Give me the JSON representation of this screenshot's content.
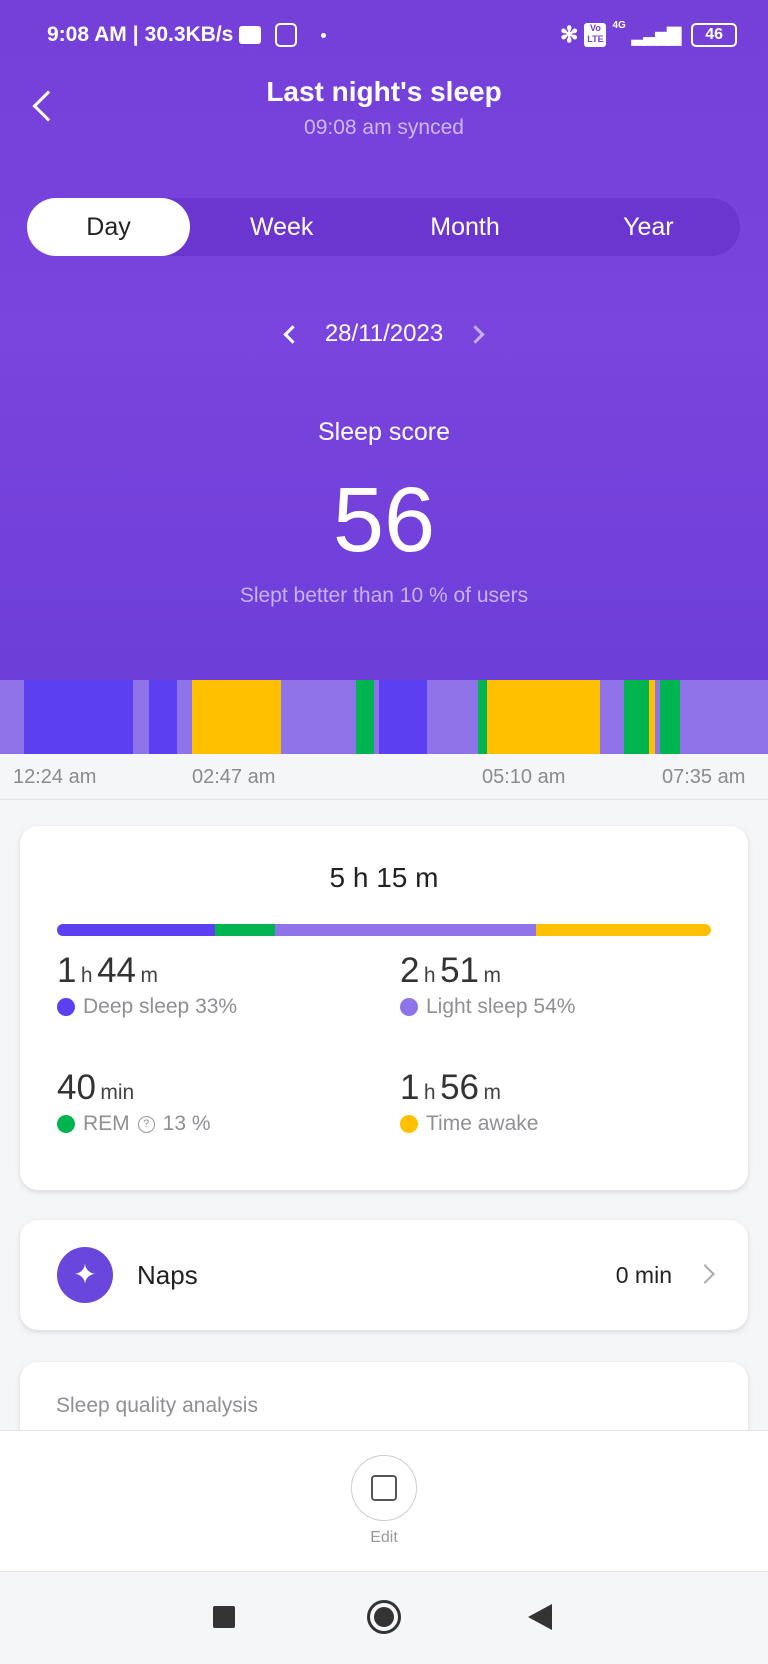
{
  "status_bar": {
    "time": "9:08 AM",
    "speed": "30.3KB/s",
    "battery": "46",
    "network": "4G",
    "volte": "Vo LTE"
  },
  "header": {
    "title": "Last night's sleep",
    "synced": "09:08 am synced"
  },
  "tabs": [
    {
      "label": "Day",
      "active": true
    },
    {
      "label": "Week"
    },
    {
      "label": "Month"
    },
    {
      "label": "Year"
    }
  ],
  "date": "28/11/2023",
  "score": {
    "label": "Sleep score",
    "value": "56",
    "comparison": "Slept better than 10 % of users"
  },
  "colors": {
    "deep": "#5c3ff0",
    "light": "#8f73e8",
    "rem": "#00b54f",
    "awake": "#ffc000",
    "header": "#7340d8"
  },
  "timeline": {
    "segments": [
      [
        "light",
        3.1
      ],
      [
        "deep",
        14.2
      ],
      [
        "light",
        2.1
      ],
      [
        "deep",
        3.6
      ],
      [
        "light",
        2
      ],
      [
        "awake",
        11.6
      ],
      [
        "light",
        9.8
      ],
      [
        "rem",
        2.3
      ],
      [
        "light",
        0.7
      ],
      [
        "deep",
        6.2
      ],
      [
        "light",
        6.6
      ],
      [
        "rem",
        1.2
      ],
      [
        "awake",
        14.7
      ],
      [
        "light",
        3.1
      ],
      [
        "rem",
        3.3
      ],
      [
        "awake",
        0.8
      ],
      [
        "light",
        0.6
      ],
      [
        "rem",
        2.6
      ],
      [
        "light",
        12.5
      ]
    ],
    "labels": [
      "12:24 am",
      "02:47 am",
      "05:10 am",
      "07:35 am"
    ]
  },
  "summary": {
    "total": "5 h 15 m",
    "bar": [
      [
        "deep",
        24.2
      ],
      [
        "rem",
        9.2
      ],
      [
        "light",
        39.8
      ],
      [
        "awake",
        26.8
      ]
    ],
    "stats": [
      {
        "num1": "1",
        "u1": "h",
        "num2": "44",
        "u2": "m",
        "label": "Deep sleep 33%",
        "color": "deep"
      },
      {
        "num1": "2",
        "u1": "h",
        "num2": "51",
        "u2": "m",
        "label": "Light sleep 54%",
        "color": "light"
      },
      {
        "num1": "40",
        "u1": "min",
        "num2": "",
        "u2": "",
        "label": "REM",
        "extra": "13 %",
        "color": "rem"
      },
      {
        "num1": "1",
        "u1": "h",
        "num2": "56",
        "u2": "m",
        "label": "Time awake",
        "color": "awake"
      }
    ]
  },
  "naps": {
    "label": "Naps",
    "value": "0 min"
  },
  "analysis": {
    "title": "Sleep quality analysis"
  },
  "edit": {
    "label": "Edit"
  }
}
